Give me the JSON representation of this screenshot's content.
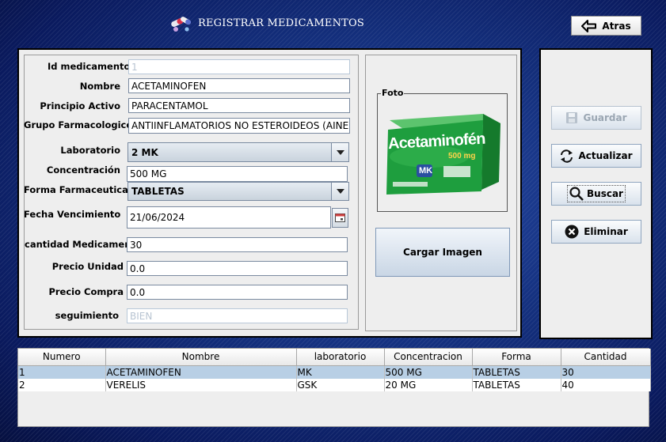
{
  "header": {
    "title": "REGISTRAR MEDICAMENTOS",
    "back_label": "Atras"
  },
  "form": {
    "id": {
      "label": "Id medicamento",
      "value": "1"
    },
    "nombre": {
      "label": "Nombre",
      "value": "ACETAMINOFEN"
    },
    "principio": {
      "label": "Principio Activo",
      "value": "PARACENTAMOL"
    },
    "grupo": {
      "label": "Grupo Farmacologico",
      "value": "ANTIINFLAMATORIOS NO ESTEROIDEOS (AINE)"
    },
    "laboratorio": {
      "label": "Laboratorio",
      "value": "2 MK"
    },
    "concentracion": {
      "label": "Concentración",
      "value": "500 MG"
    },
    "forma": {
      "label": "Forma Farmaceutica",
      "value": "TABLETAS"
    },
    "fecha": {
      "label": "Fecha Vencimiento",
      "value": "21/06/2024"
    },
    "cantidad": {
      "label": "cantidad Medicamento",
      "value": "30"
    },
    "precio_unidad": {
      "label": "Precio Unidad",
      "value": "0.0"
    },
    "precio_compra": {
      "label": "Precio Compra",
      "value": "0.0"
    },
    "seguimiento": {
      "label": "seguimiento",
      "value": "BIEN"
    }
  },
  "photo": {
    "legend": "Foto",
    "box_brand": "Acetaminofén",
    "box_dose": "500 mg",
    "box_logo": "MK",
    "upload_label": "Cargar Imagen"
  },
  "actions": {
    "guardar": "Guardar",
    "actualizar": "Actualizar",
    "buscar": "Buscar",
    "eliminar": "Eliminar"
  },
  "table": {
    "columns": [
      "Numero",
      "Nombre",
      "laboratorio",
      "Concentracion",
      "Forma",
      "Cantidad"
    ],
    "rows": [
      [
        "1",
        "ACETAMINOFEN",
        "MK",
        "500 MG",
        "TABLETAS",
        "30"
      ],
      [
        "2",
        "VERELIS",
        "GSK",
        "20 MG",
        "TABLETAS",
        "40"
      ]
    ],
    "selected_row": 0
  },
  "colors": {
    "background": "#0a1a5e",
    "panel": "#eeeeee",
    "selection": "#b8cfe5",
    "box_green": "#1e9e3e"
  }
}
